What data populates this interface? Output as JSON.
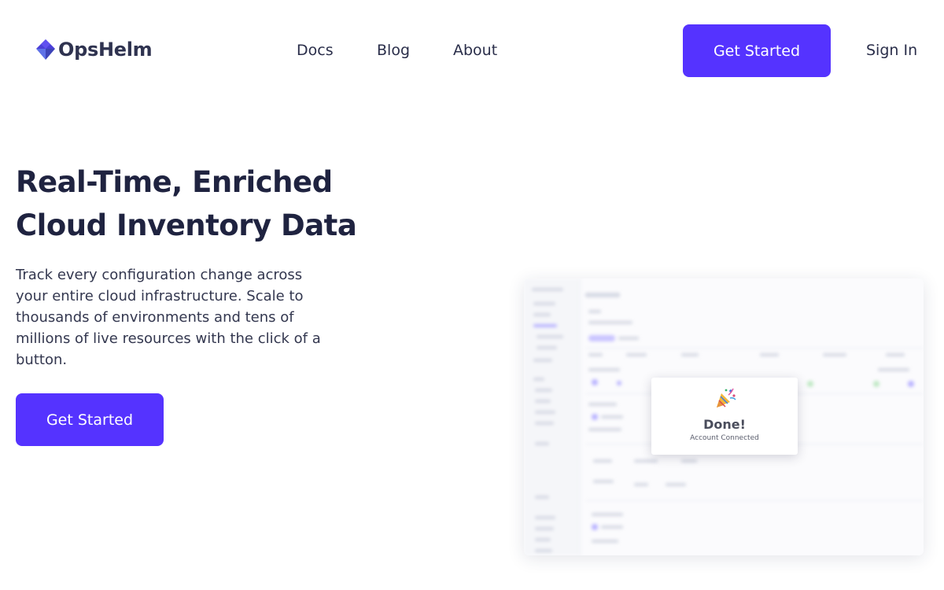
{
  "header": {
    "logo_text": "OpsHelm",
    "nav": {
      "docs": "Docs",
      "blog": "Blog",
      "about": "About"
    },
    "cta_label": "Get Started",
    "sign_in_label": "Sign In"
  },
  "hero": {
    "title_line1": "Real-Time, Enriched",
    "title_line2": "Cloud Inventory Data",
    "subtitle": "Track every configuration change across your entire cloud infrastructure. Scale to thousands of environments and tens of millions of live resources with the click of a button.",
    "cta_label": "Get Started"
  },
  "preview": {
    "modal_title": "Done!",
    "modal_subtitle": "Account Connected",
    "icon": "party-popper-icon"
  },
  "colors": {
    "accent": "#5533ff",
    "text_dark": "#1f2340",
    "background": "#ffffff"
  }
}
